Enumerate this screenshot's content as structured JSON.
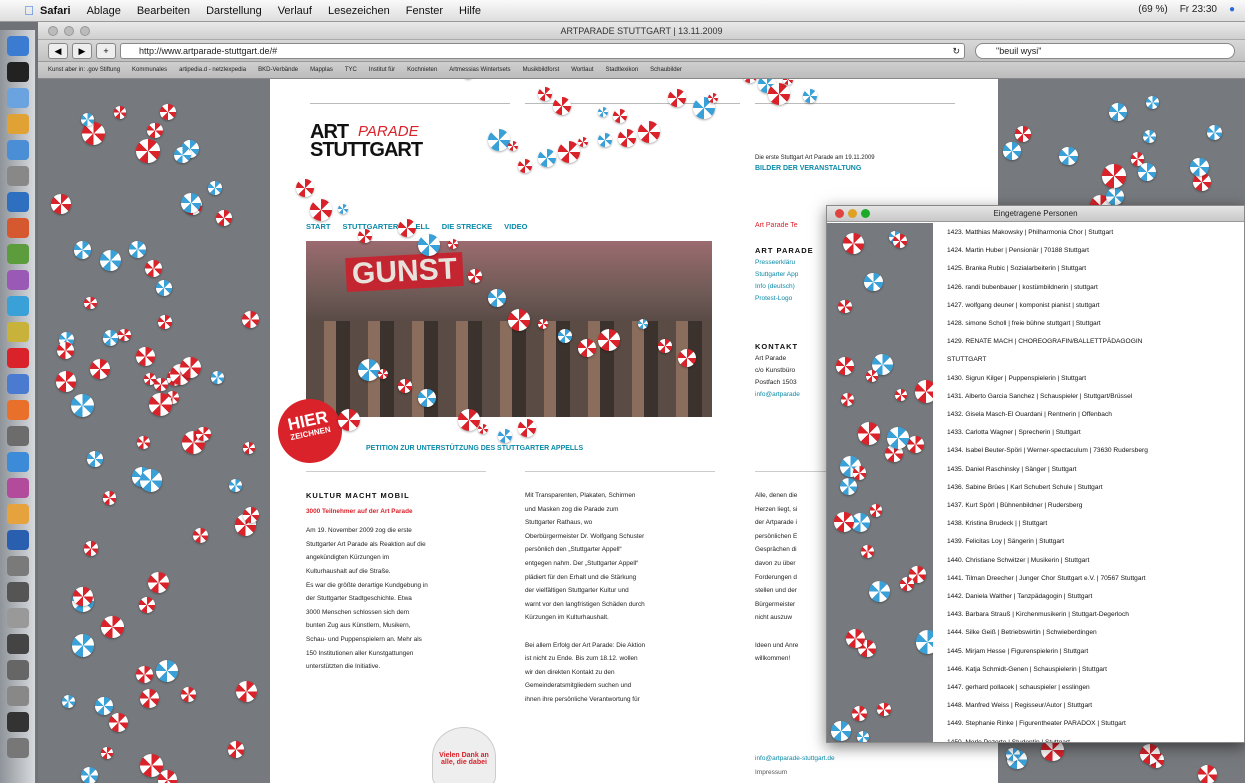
{
  "menubar": {
    "app": "Safari",
    "items": [
      "Ablage",
      "Bearbeiten",
      "Darstellung",
      "Verlauf",
      "Lesezeichen",
      "Fenster",
      "Hilfe"
    ],
    "status_right": [
      "(69 %)",
      "Fr 23:30"
    ]
  },
  "browser": {
    "window_title": "ARTPARADE STUTTGART | 13.11.2009",
    "url": "http://www.artparade-stuttgart.de/#",
    "search_value": "\"beuil wysi\"",
    "bookmarks": [
      "Kunst aber in: .gov Stiftung",
      "Kommunales",
      "artipedia.d - netzlexpedia",
      "BKD-Verbände",
      "Mapplas",
      "TYC",
      "Institut für",
      "Kochnieten",
      "Artmessias Wintertsets",
      "Musikbildforst",
      "Wortlaut",
      "Stadtlexikon",
      "Schaubilder"
    ]
  },
  "page": {
    "logo_line1": "ART",
    "logo_parade": "PARADE",
    "logo_line2": "STUTTGART",
    "teaser": "Die erste Stuttgart Art Parade am 19.11.2009",
    "teaser_link": "BILDER DER VERANSTALTUNG",
    "nav": [
      "START",
      "STUTTGARTER APPELL",
      "DIE STRECKE",
      "VIDEO"
    ],
    "nav_red": "Art Parade Te",
    "hero_banner": "GUNST",
    "hier_line1": "HIER",
    "hier_line2": "ZEICHNEN",
    "petition": "PETITION ZUR UNTERSTÜTZUNG DES STUTTGARTER APPELLS",
    "left_col": {
      "heading": "KULTUR MACHT MOBIL",
      "subheading": "3000 Teilnehmer auf der Art Parade",
      "lines": [
        "Am 19. November 2009 zog die erste",
        "Stuttgarter Art Parade als Reaktion auf die",
        "angekündigten Kürzungen im",
        "Kulturhaushalt auf die Straße.",
        "Es war die größte derartige Kundgebung in",
        "der Stuttgarter Stadtgeschichte. Etwa",
        "3000 Menschen schlossen sich dem",
        "bunten Zug aus Künstlern, Musikern,",
        "Schau- und Puppenspielern an. Mehr als",
        "150 Institutionen aller Kunstgattungen",
        "unterstützten die Initiative."
      ]
    },
    "mid_col": {
      "lines": [
        "Mit Transparenten, Plakaten, Schirmen",
        "und Masken zog die Parade zum",
        "Stuttgarter Rathaus, wo",
        "Oberbürgermeister Dr. Wolfgang Schuster",
        "persönlich den „Stuttgarter Appell“",
        "entgegen nahm. Der „Stuttgarter Appell“",
        "plädiert für den Erhalt und die Stärkung",
        "der vielfältigen Stuttgarter Kultur und",
        "warnt vor den langfristigen Schäden durch",
        "Kürzungen im Kulturhaushalt.",
        "",
        "Bei allem Erfolg der Art Parade: Die Aktion",
        "ist nicht zu Ende. Bis zum 18.12. wollen",
        "wir den direkten Kontakt zu den",
        "Gemeinderatsmitgliedern suchen und",
        "ihnen ihre persönliche Verantwortung für"
      ]
    },
    "third_col": {
      "lines": [
        "Alle, denen die",
        "Herzen liegt, si",
        "der Artparade i",
        "persönlichen E",
        "Gesprächen di",
        "davon zu über",
        "Forderungen d",
        "stellen und der",
        "Bürgermeister",
        "nicht auszuw",
        "",
        "Ideen und Anre",
        "willkommen!"
      ]
    },
    "right_col": {
      "heading1": "ART PARADE",
      "links1": [
        "Presseerkläru",
        "Stuttgarter App",
        "Info (deutsch)",
        "Protest-Logo"
      ],
      "heading2": "KONTAKT",
      "contact": [
        "Art Parade",
        "c/o Kunstbüro",
        "Postfach 1503",
        "info@artparade"
      ]
    },
    "danke": "Vielen Dank an alle, die dabei",
    "email": "info@artparade-stuttgart.de",
    "footer_small": "Impressum"
  },
  "people_window": {
    "title": "Eingetragene Personen",
    "entries": [
      "1423. Matthias Makowsky  |  Philharmonia Chor  |  Stuttgart",
      "1424. Martin Huber  |  Pensionär  |  70188 Stuttgart",
      "1425. Branka Rubic  |  Sozialarbeiterin  |  Stuttgart",
      "1426. randi bubenbauer  |  kostümbildnerin  |  stuttgart",
      "1427. wolfgang deuner  |  komponist pianist  |  stuttgart",
      "1428. simone Scholl  |  freie bühne stuttgart  |  Stuttgart",
      "1429. RENATE MACH  |  CHOREOGRAFIN/BALLETTPÄDAGOGIN",
      "STUTTGART",
      "1430. Sigrun Kilger  |  Puppenspielerin  |  Stuttgart",
      "1431. Alberto Garcia Sanchez  |  Schauspieler  |  Stuttgart/Brüssel",
      "1432. Gisela Masch-El Ouardani  |  Rentnerin  |  Offenbach",
      "1433. Carlotta Wagner  |  Sprecherin  |  Stuttgart",
      "1434. Isabel Beuter-Spöri  |  Werner-spectaculum  |  73630 Rudersberg",
      "1435. Daniel Raschinsky  |  Sänger  |  Stuttgart",
      "1436. Sabine Brües  |  Karl Schubert Schule  |  Stuttgart",
      "1437. Kurt Spörl  |  Bühnenbildner  |  Rudersberg",
      "1438. Kristina Brudeck  |    |  Stuttgart",
      "1439. Felicitas Loy  |  Sängerin  |  Stuttgart",
      "1440. Christiane Schwitzer  |  Musikerin  |  Stuttgart",
      "1441. Tilman Dreecher  |  Junger Chor Stuttgart e.V.  |  70567 Stuttgart",
      "1442. Daniela Walther  |  Tanzpädagogin  |  Stuttgart",
      "1443. Barbara Strauß  |  Kirchenmusikerin  |  Stuttgart-Degerloch",
      "1444. Silke Geiß  |  Betriebswirtin  |  Schwieberdingen",
      "1445. Mirjam Hesse  |  Figurenspielerin  |  Stuttgart",
      "1446. Katja Schmidt-Genen  |  Schauspielerin  |  Stuttgart",
      "1447. gerhard pollacek  |  schauspieler  |  esslingen",
      "1448. Manfred Weiss  |  Regisseur/Autor  |  Stuttgart",
      "1449. Stephanie Rinke  |  Figurentheater PARADOX  |  Stuttgart",
      "1450. Merle Pozorte  |  Studentin  |  Stuttgart"
    ]
  },
  "colors": {
    "accent_red": "#d9222a",
    "link_teal": "#0a8aa8",
    "candy_blue": "#3aa0d8",
    "background_grey": "#76797d"
  },
  "icons": [
    "apple-menu-icon",
    "dock-app-icon",
    "candy-red-icon",
    "candy-blue-icon"
  ]
}
